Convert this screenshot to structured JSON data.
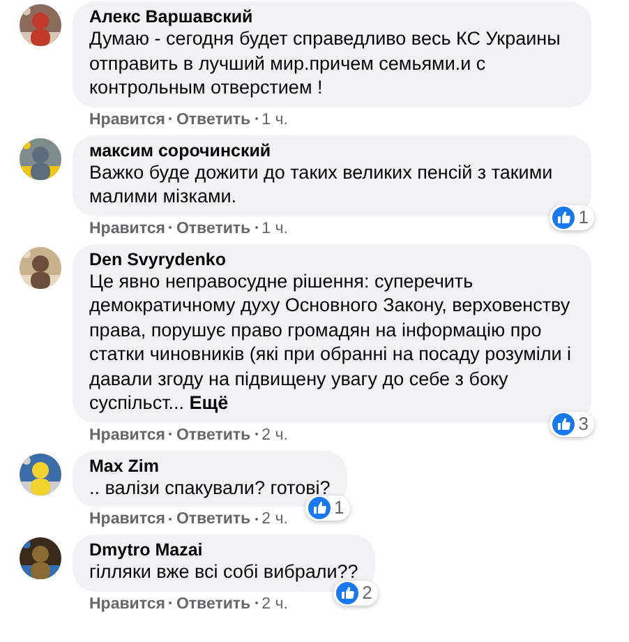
{
  "comments": [
    {
      "author": "Алекс Варшавский",
      "text": "Думаю - сегодня будет справедливо весь КС Украины отправить в лучший мир.причем семьями.и с контрольным отверстием !",
      "like": "Нравится",
      "reply": "Ответить",
      "time": "1 ч."
    },
    {
      "author": "максим сорочинский",
      "text": "Важко буде дожити до таких великих пенсій з такими малими мізками.",
      "reactions": "1",
      "like": "Нравится",
      "reply": "Ответить",
      "time": "1 ч."
    },
    {
      "author": "Den Svyrydenko",
      "text": "Це явно неправосудне рішення: суперечить демократичному духу Основного Закону, верховенству права, порушує право громадян на інформацію про статки чиновників (які при обранні на посаду розуміли і давали згоду на підвищену увагу до себе з боку суспільст...",
      "see_more": "Ещё",
      "reactions": "3",
      "like": "Нравится",
      "reply": "Ответить",
      "time": "2 ч."
    },
    {
      "author": "Max Zim",
      "text": ".. валізи спакували? готові?",
      "reactions": "1",
      "like": "Нравится",
      "reply": "Ответить",
      "time": "2 ч."
    },
    {
      "author": "Dmytro Mazai",
      "text": "гілляки вже всі собі вибрали??",
      "reactions": "2",
      "like": "Нравится",
      "reply": "Ответить",
      "time": "2 ч."
    }
  ]
}
